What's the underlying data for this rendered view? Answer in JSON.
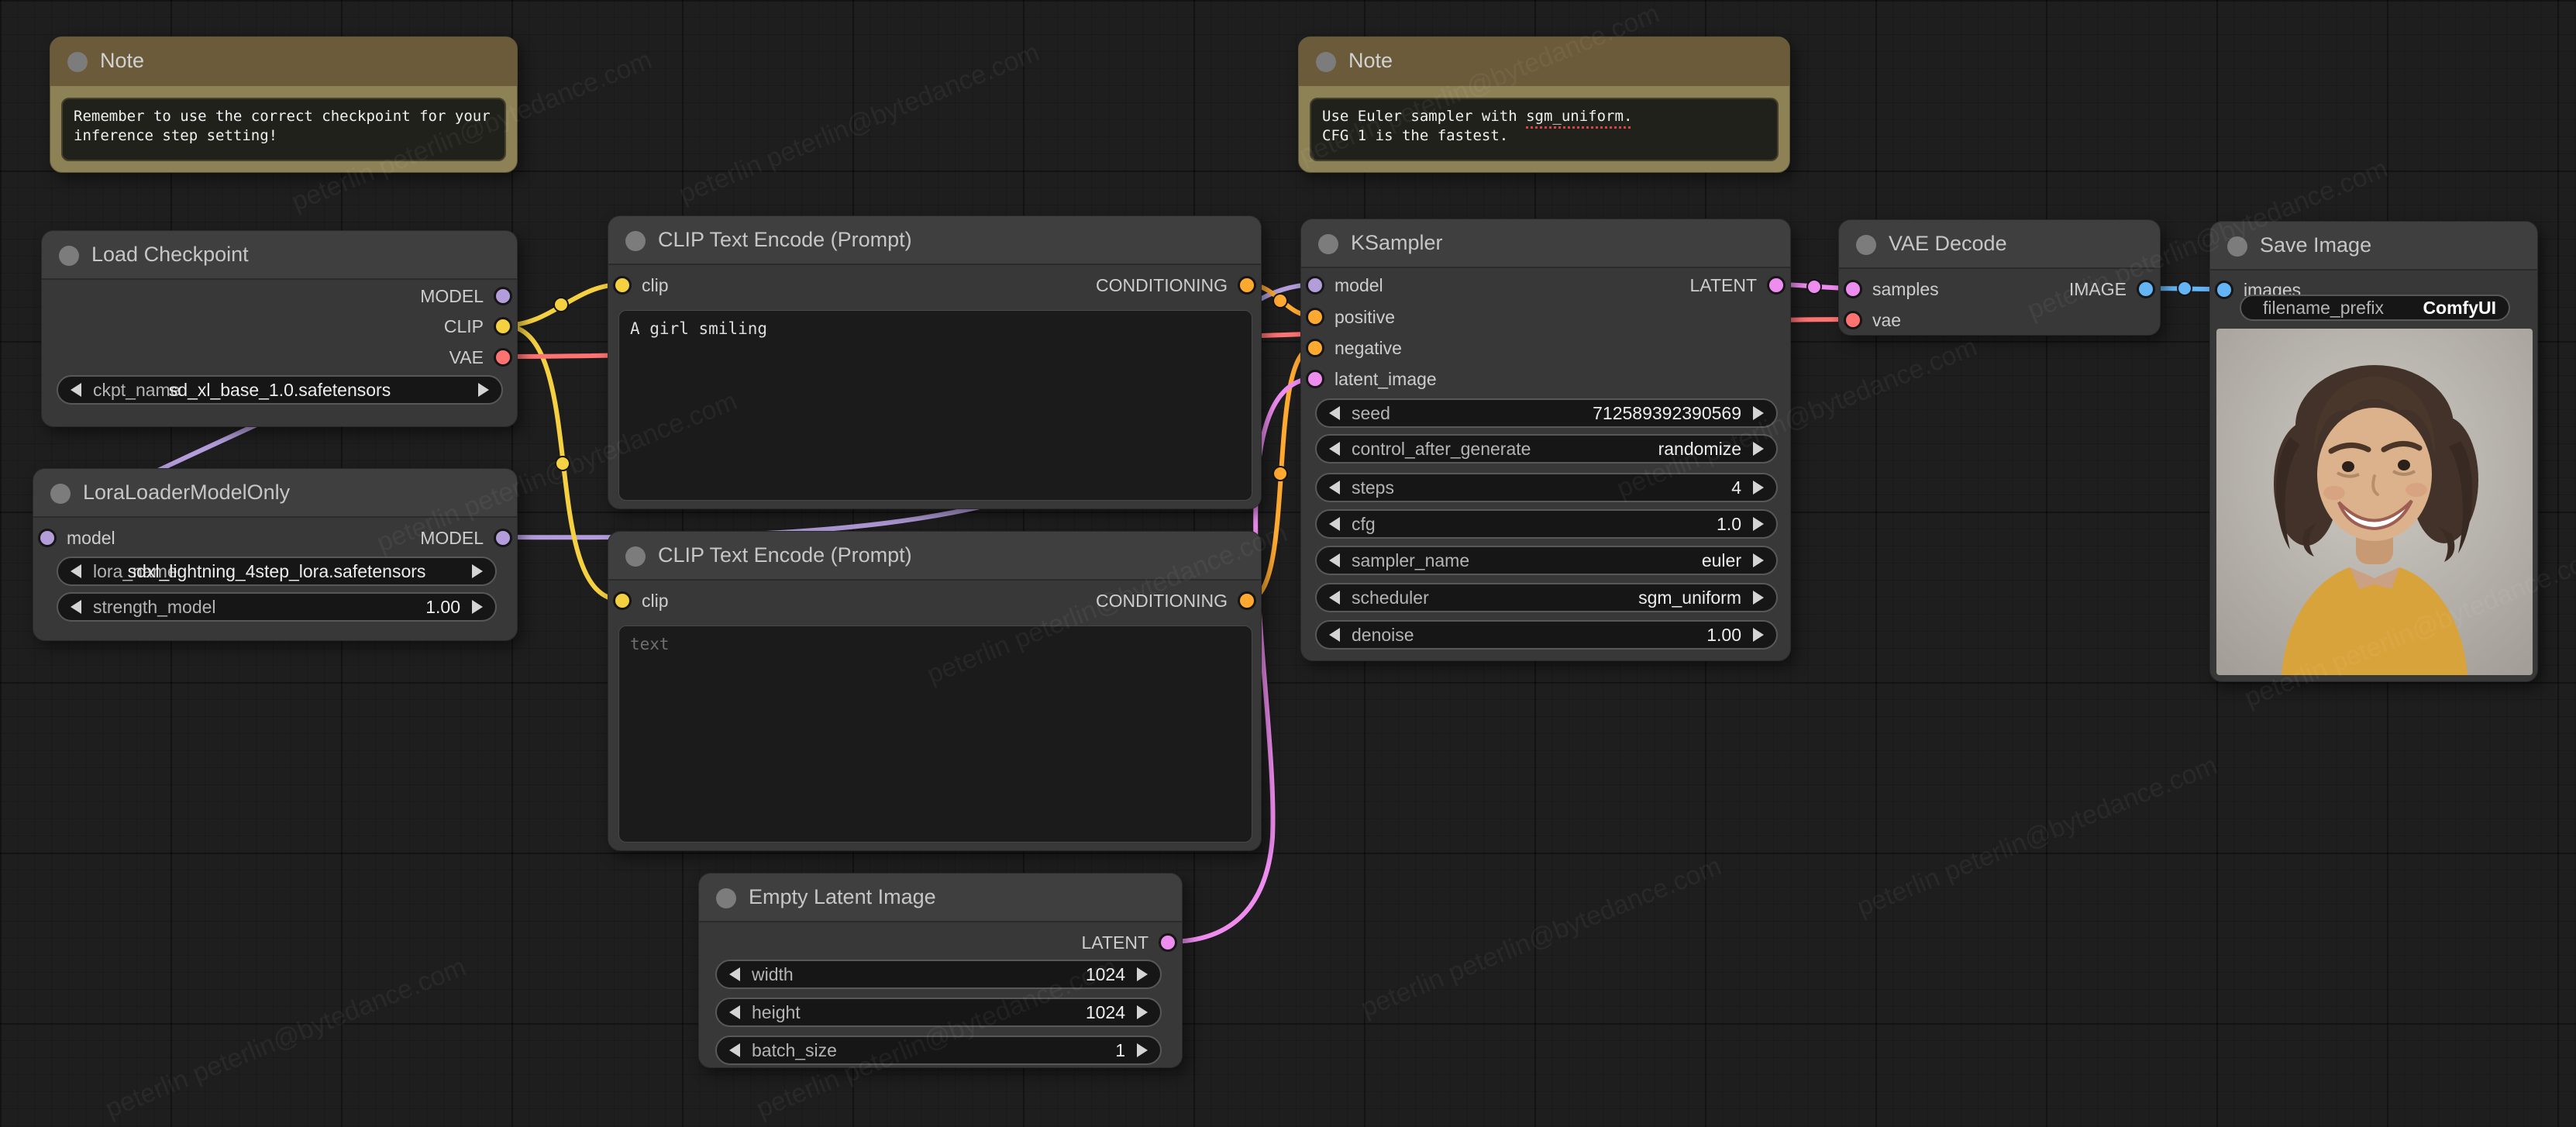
{
  "watermark": {
    "text": "peterlin peterlin@bytedance.com"
  },
  "colors": {
    "canvas_bg": "#1e1e1e",
    "node_bg": "#383838",
    "node_title": "#3f3f3f",
    "note_header": "#6b5b3b",
    "note_body": "#8d8156",
    "model": "#b39ddb",
    "clip": "#f5d041",
    "vae": "#ff7272",
    "conditioning": "#ffa931",
    "latent": "#ef8cf0",
    "image": "#64b5f6"
  },
  "note1": {
    "title": "Note",
    "body": "Remember to use the correct checkpoint for your inference step setting!"
  },
  "note2": {
    "title": "Note",
    "line1_pre": "Use Euler sampler with ",
    "line1_flagged": "sgm_uniform.",
    "line2": "CFG 1 is the fastest."
  },
  "load_checkpoint": {
    "title": "Load Checkpoint",
    "outputs": {
      "model": "MODEL",
      "clip": "CLIP",
      "vae": "VAE"
    },
    "ckpt": {
      "label": "ckpt_name",
      "value": "sd_xl_base_1.0.safetensors"
    }
  },
  "lora": {
    "title": "LoraLoaderModelOnly",
    "input_model": "model",
    "output_model": "MODEL",
    "lora_name": {
      "label": "lora_name",
      "value": "sdxl_lightning_4step_lora.safetensors"
    },
    "strength": {
      "label": "strength_model",
      "value": "1.00"
    }
  },
  "clip_positive": {
    "title": "CLIP Text Encode (Prompt)",
    "input": "clip",
    "output": "CONDITIONING",
    "text": "A girl smiling"
  },
  "clip_negative": {
    "title": "CLIP Text Encode (Prompt)",
    "input": "clip",
    "output": "CONDITIONING",
    "placeholder": "text"
  },
  "empty_latent": {
    "title": "Empty Latent Image",
    "output": "LATENT",
    "widgets": [
      {
        "label": "width",
        "value": "1024"
      },
      {
        "label": "height",
        "value": "1024"
      },
      {
        "label": "batch_size",
        "value": "1"
      }
    ]
  },
  "ksampler": {
    "title": "KSampler",
    "inputs": {
      "model": "model",
      "positive": "positive",
      "negative": "negative",
      "latent": "latent_image"
    },
    "output": "LATENT",
    "widgets": [
      {
        "label": "seed",
        "value": "712589392390569"
      },
      {
        "label": "control_after_generate",
        "value": "randomize"
      },
      {
        "label": "steps",
        "value": "4"
      },
      {
        "label": "cfg",
        "value": "1.0"
      },
      {
        "label": "sampler_name",
        "value": "euler"
      },
      {
        "label": "scheduler",
        "value": "sgm_uniform"
      },
      {
        "label": "denoise",
        "value": "1.00"
      }
    ]
  },
  "vae_decode": {
    "title": "VAE Decode",
    "inputs": {
      "samples": "samples",
      "vae": "vae"
    },
    "output": "IMAGE"
  },
  "save_image": {
    "title": "Save Image",
    "input": "images",
    "prefix": {
      "label": "filename_prefix",
      "value": "ComfyUI"
    }
  }
}
